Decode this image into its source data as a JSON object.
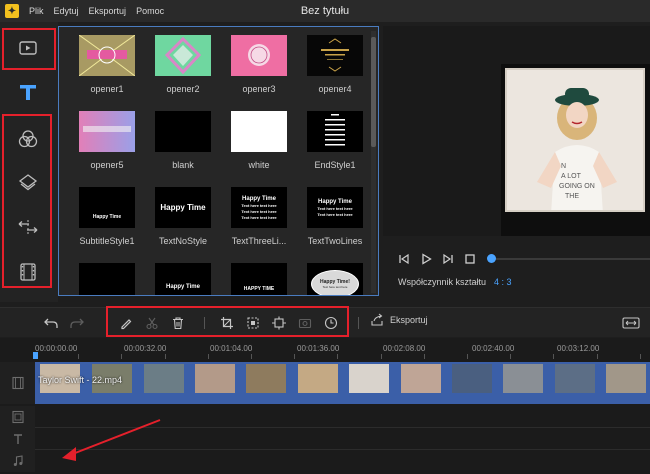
{
  "window": {
    "title": "Bez tytułu",
    "logo_icon": "app-logo-icon"
  },
  "menu": [
    "Plik",
    "Edytuj",
    "Eksportuj",
    "Pomoc"
  ],
  "sidebar": {
    "items": [
      {
        "name": "media",
        "icon": "media-icon"
      },
      {
        "name": "text",
        "icon": "text-icon",
        "active": true
      },
      {
        "name": "filters",
        "icon": "filters-icon"
      },
      {
        "name": "overlays",
        "icon": "overlays-icon"
      },
      {
        "name": "transitions",
        "icon": "transitions-icon"
      },
      {
        "name": "film",
        "icon": "film-icon"
      }
    ],
    "accent_color": "#4aa3ff"
  },
  "templates": [
    {
      "label": "opener1",
      "thumb": "opener1"
    },
    {
      "label": "opener2",
      "thumb": "opener2"
    },
    {
      "label": "opener3",
      "thumb": "opener3"
    },
    {
      "label": "opener4",
      "thumb": "opener4"
    },
    {
      "label": "opener5",
      "thumb": "opener5"
    },
    {
      "label": "blank",
      "thumb": "blank"
    },
    {
      "label": "white",
      "thumb": "white"
    },
    {
      "label": "EndStyle1",
      "thumb": "endstyle1"
    },
    {
      "label": "SubtitleStyle1",
      "thumb": "subtitle",
      "text": "Happy Time"
    },
    {
      "label": "TextNoStyle",
      "thumb": "nostyle",
      "text": "Happy Time"
    },
    {
      "label": "TextThreeLi...",
      "thumb": "threelines",
      "lines": [
        "Happy Time",
        "Text here text here",
        "Text here text here",
        "Text here text here"
      ]
    },
    {
      "label": "TextTwoLines",
      "thumb": "twolines",
      "lines": [
        "Happy Time",
        "Text here text here",
        "Text here text here"
      ]
    },
    {
      "label": "",
      "thumb": "row4a"
    },
    {
      "label": "",
      "thumb": "row4b",
      "text": "Happy Time"
    },
    {
      "label": "",
      "thumb": "row4c",
      "text": "HAPPY TIME"
    },
    {
      "label": "",
      "thumb": "row4d",
      "lines": [
        "Happy Time!",
        "Text here text here"
      ]
    }
  ],
  "preview": {
    "aspect_label": "Współczynnik kształtu",
    "aspect_value": "4 : 3",
    "playback_progress": 0.0
  },
  "toolbar": {
    "export_label": "Eksportuj",
    "highlight_color": "#e5202b"
  },
  "timeline": {
    "ticks": [
      "00:00:00.00",
      "00:00:32.00",
      "00:01:04.00",
      "00:01:36.00",
      "00:02:08.00",
      "00:02:40.00",
      "00:03:12.00"
    ],
    "clip_name": "Taylor Swift - 22.mp4"
  }
}
